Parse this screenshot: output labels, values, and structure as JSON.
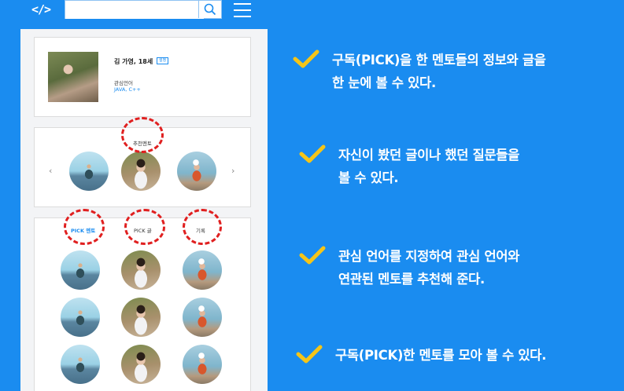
{
  "header": {
    "logo": "</>",
    "search_placeholder": ""
  },
  "profile": {
    "name": "김 가영, 18세",
    "badge": "설정",
    "lang_label": "관심언어",
    "langs": "JAVA,  C++"
  },
  "recommend": {
    "title": "추천멘토",
    "prev": "‹",
    "next": "›"
  },
  "tabs": [
    {
      "label": "PICK 멘토",
      "active": true
    },
    {
      "label": "PICK 글",
      "active": false
    },
    {
      "label": "기록",
      "active": false
    }
  ],
  "features": [
    {
      "line1": "구독(PICK)을 한 멘토들의 정보와 글을",
      "line2": "한 눈에 볼 수 있다."
    },
    {
      "line1": "자신이 봤던 글이나 했던 질문들을",
      "line2": "볼 수 있다."
    },
    {
      "line1": "관심 언어를 지정하여 관심 언어와",
      "line2": "연관된 멘토를 추천해 준다."
    },
    {
      "line1": "구독(PICK)한 멘토를 모아 볼 수 있다.",
      "line2": ""
    }
  ],
  "colors": {
    "background": "#1a8cf0",
    "check": "#f5c518",
    "annotation": "#e02020",
    "accent": "#1a8cf0"
  },
  "icons": [
    "code-logo-icon",
    "search-icon",
    "hamburger-menu-icon",
    "chevron-left-icon",
    "chevron-right-icon",
    "checkmark-icon"
  ]
}
